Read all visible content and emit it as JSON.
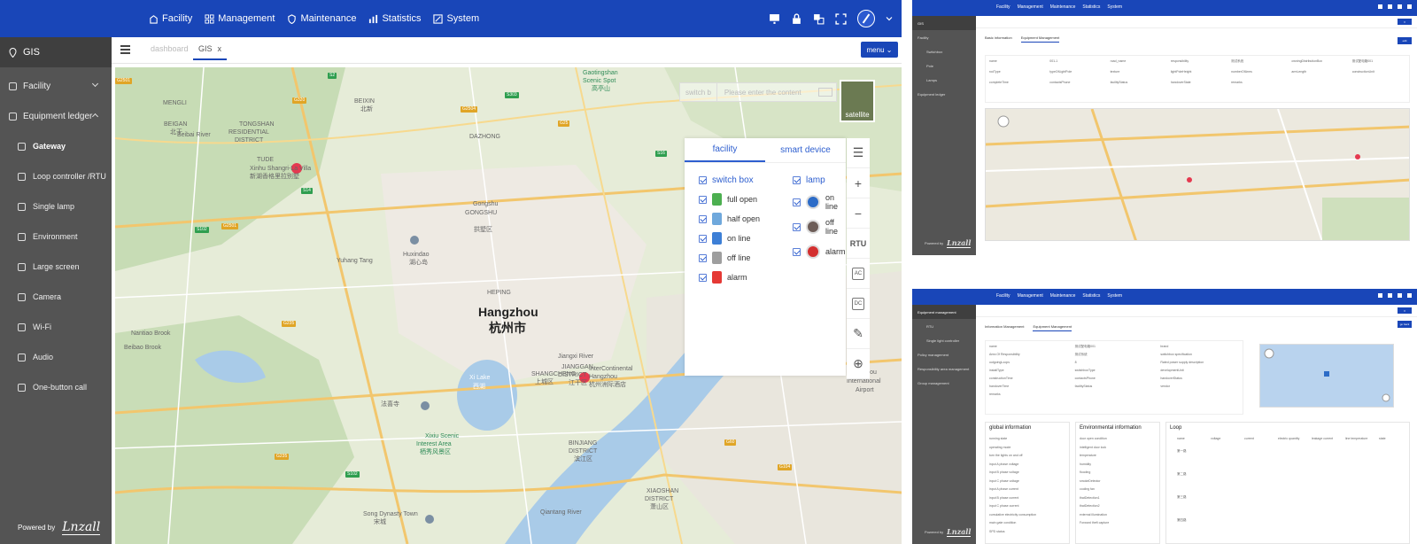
{
  "nav": {
    "items": [
      {
        "label": "Facility",
        "icon": "facility-icon"
      },
      {
        "label": "Management",
        "icon": "grid-icon"
      },
      {
        "label": "Maintenance",
        "icon": "shield-icon"
      },
      {
        "label": "Statistics",
        "icon": "bar-chart-icon"
      },
      {
        "label": "System",
        "icon": "system-icon"
      }
    ]
  },
  "sidebar": {
    "gis": "GIS",
    "facility": "Facility",
    "ledger": "Equipment ledger",
    "subitems": [
      "Gateway",
      "Loop controller /RTU",
      "Single lamp",
      "Environment",
      "Large screen",
      "Camera",
      "Wi-Fi",
      "Audio",
      "One-button call"
    ],
    "powered": "Powered by",
    "logo": "Lnzall"
  },
  "tabs": {
    "dashboard": "dashboard",
    "gis": "GIS",
    "close": "x",
    "menu": "menu"
  },
  "search": {
    "type": "switch b",
    "placeholder": "Please enter the content"
  },
  "satellite": "satellite",
  "panel": {
    "tabs": [
      "facility",
      "smart device"
    ],
    "left_head": "switch box",
    "left_items": [
      {
        "label": "full open",
        "color": "#4caf50"
      },
      {
        "label": "half open",
        "color": "#6fa8dc"
      },
      {
        "label": "on line",
        "color": "#3d7fd6"
      },
      {
        "label": "off line",
        "color": "#9e9e9e"
      },
      {
        "label": "alarm",
        "color": "#e53935"
      }
    ],
    "right_head": "lamp",
    "right_items": [
      {
        "label": "on line",
        "color": "#2d6cc7"
      },
      {
        "label": "off line",
        "color": "#6d5d58"
      },
      {
        "label": "alarm",
        "color": "#d32f2f"
      }
    ]
  },
  "tools": {
    "rtu": "RTU",
    "ac": "AC",
    "dc": "DC",
    "plus": "+",
    "minus": "−"
  },
  "map": {
    "labels": [
      {
        "text": "Gaotingshan",
        "kind": "green"
      },
      {
        "text": "Scenic Spot",
        "kind": "green"
      },
      {
        "text": "高亭山",
        "kind": "green"
      },
      {
        "text": "BEIXIN",
        "kind": ""
      },
      {
        "text": "北新",
        "kind": ""
      },
      {
        "text": "BEIGAN",
        "kind": ""
      },
      {
        "text": "北干",
        "kind": ""
      },
      {
        "text": "TONGSHAN",
        "kind": ""
      },
      {
        "text": "RESIDENTIAL",
        "kind": ""
      },
      {
        "text": "DISTRICT",
        "kind": ""
      },
      {
        "text": "Beibai River",
        "kind": ""
      },
      {
        "text": "TUDE",
        "kind": ""
      },
      {
        "text": "DAZHONG",
        "kind": ""
      },
      {
        "text": "Gongshu",
        "kind": ""
      },
      {
        "text": "GONGSHU",
        "kind": ""
      },
      {
        "text": "拱墅区",
        "kind": ""
      },
      {
        "text": "Huxindao",
        "kind": ""
      },
      {
        "text": "湖心岛",
        "kind": ""
      },
      {
        "text": "Xinhu Shangri-La Villa",
        "kind": ""
      },
      {
        "text": "新湖香格里拉别墅",
        "kind": ""
      },
      {
        "text": "Hangzhou",
        "kind": "city"
      },
      {
        "text": "杭州市",
        "kind": "city"
      },
      {
        "text": "Jiangxi River",
        "kind": ""
      },
      {
        "text": "JIANGGAN",
        "kind": ""
      },
      {
        "text": "DISTRICT",
        "kind": ""
      },
      {
        "text": "江干区",
        "kind": ""
      },
      {
        "text": "Xi Lake",
        "kind": "blue"
      },
      {
        "text": "西湖",
        "kind": "blue"
      },
      {
        "text": "SHANGCHENG",
        "kind": ""
      },
      {
        "text": "上城区",
        "kind": ""
      },
      {
        "text": "InterContinental",
        "kind": ""
      },
      {
        "text": "Hangzhou",
        "kind": ""
      },
      {
        "text": "杭州洲际酒店",
        "kind": ""
      },
      {
        "text": "Xixiu Scenic",
        "kind": "green"
      },
      {
        "text": "Interest Area",
        "kind": "green"
      },
      {
        "text": "栖秀风景区",
        "kind": "green"
      },
      {
        "text": "BINJIANG",
        "kind": ""
      },
      {
        "text": "DISTRICT",
        "kind": ""
      },
      {
        "text": "滨江区",
        "kind": ""
      },
      {
        "text": "XIAOSHAN",
        "kind": ""
      },
      {
        "text": "DISTRICT",
        "kind": ""
      },
      {
        "text": "萧山区",
        "kind": ""
      },
      {
        "text": "Song Dynasty Town",
        "kind": ""
      },
      {
        "text": "宋城",
        "kind": ""
      },
      {
        "text": "Qiantang River",
        "kind": ""
      },
      {
        "text": "Hangzhou",
        "kind": ""
      },
      {
        "text": "International",
        "kind": ""
      },
      {
        "text": "Airport",
        "kind": ""
      },
      {
        "text": "Nantiao Brook",
        "kind": ""
      },
      {
        "text": "Yuhang Tang",
        "kind": ""
      },
      {
        "text": "法喜寺",
        "kind": ""
      },
      {
        "text": "Beibao Brook",
        "kind": ""
      },
      {
        "text": "MENGLI",
        "kind": ""
      },
      {
        "text": "HEPING",
        "kind": ""
      }
    ],
    "badges": [
      "G2501",
      "G320",
      "S2",
      "G2504",
      "S14",
      "S102",
      "S16",
      "G25",
      "S303",
      "G2501",
      "G104",
      "G60",
      "G235",
      "G235",
      "S102"
    ]
  },
  "thumbA": {
    "nav": [
      "Facility",
      "Management",
      "Maintenance",
      "Statistics",
      "System"
    ],
    "side": [
      "GIS",
      "Facility",
      "Switchbox",
      "Pole",
      "Lamps",
      "Equipment ledger"
    ],
    "subtabs": [
      "Basic information",
      "Equipment Management"
    ],
    "btn": "edit",
    "fields": [
      "name",
      "001-1",
      "road_name",
      "responsibility",
      "测试系统",
      "owningDistributionBox",
      "测试配电箱001",
      "rodType",
      "typeOfLightPole",
      "texture",
      "lightPoleHeight",
      "numberOfArms",
      "armLength",
      "constructionUnit",
      "completeTime",
      "contactsPhone",
      "facilityStatus",
      "handoverState",
      "remarks"
    ],
    "powered": "Powered by",
    "logo": "Lnzall"
  },
  "thumbB": {
    "nav": [
      "Facility",
      "Management",
      "Maintenance",
      "Statistics",
      "System"
    ],
    "side": [
      "Equipment management",
      "RTU",
      "Single light controller",
      "Policy management",
      "Responsibility area management",
      "Group management"
    ],
    "subtabs": [
      "Information Management",
      "Equipment Management"
    ],
    "btn": "go back",
    "fields": [
      "name",
      "测试配电箱001",
      "brand",
      "Area Of Responsibility",
      "测试系统",
      "switchbox specification",
      "outgoingLoops",
      "8",
      "Rated power supply description",
      "installType",
      "switchboxType",
      "developmentUnit",
      "constructionTime",
      "contactsPhone",
      "handoverStatus",
      "handoverTime",
      "facilityStatus",
      "vendor",
      "remarks"
    ],
    "sections": [
      {
        "title": "global information",
        "rows": [
          "running state",
          "operating mode",
          "turn the lights on and off",
          "input A phase voltage",
          "input B phase voltage",
          "input C phase voltage",
          "input A phase current",
          "input B phase current",
          "input C phase current",
          "cumulative electricity consumption",
          "main gate condition",
          "SPD status"
        ]
      },
      {
        "title": "Environmental information",
        "rows": [
          "door open condition",
          "intelligent door lock",
          "temperature",
          "humidity",
          "flooding",
          "smokeDetector",
          "cooling fan",
          "thatDetection1",
          "thatDetection2",
          "external illumination",
          "Forward theft capture"
        ]
      },
      {
        "title": "Loop",
        "headers": [
          "name",
          "voltage",
          "current",
          "electric quantity",
          "leakage current",
          "line temperature",
          "state"
        ],
        "rows": [
          "第一路",
          "第二路",
          "第三路",
          "第四路"
        ]
      }
    ],
    "powered": "Powered by",
    "logo": "Lnzall"
  }
}
